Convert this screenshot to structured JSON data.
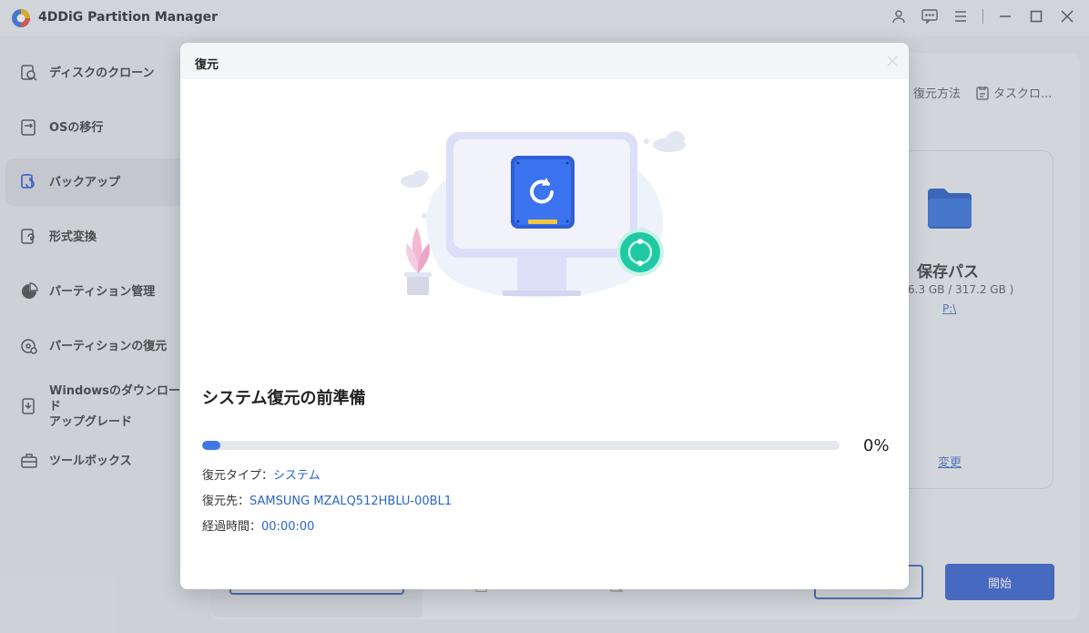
{
  "app": {
    "title": "4DDiG Partition Manager"
  },
  "window_controls": [
    "user-icon",
    "feedback-icon",
    "menu-icon",
    "minimize-icon",
    "maximize-icon",
    "close-icon"
  ],
  "sidebar": {
    "items": [
      {
        "label": "ディスクのクローン",
        "icon": "disk-clone-icon",
        "active": false
      },
      {
        "label": "OSの移行",
        "icon": "os-migrate-icon",
        "active": false
      },
      {
        "label": "バックアップ",
        "icon": "backup-icon",
        "active": true
      },
      {
        "label": "形式変換",
        "icon": "convert-icon",
        "active": false
      },
      {
        "label": "パーティション管理",
        "icon": "partition-icon",
        "active": false
      },
      {
        "label": "パーティションの復元",
        "icon": "partition-recovery-icon",
        "active": false
      },
      {
        "label": "Windowsのダウンロード\nアップグレード",
        "icon": "windows-download-icon",
        "active": false
      },
      {
        "label": "ツールボックス",
        "icon": "toolbox-icon",
        "active": false
      }
    ]
  },
  "background": {
    "toolbar": {
      "restore_method": "復元方法",
      "task_log": "タスクロ..."
    },
    "destination": {
      "title": "保存パス",
      "size": "6.3 GB / 317.2 GB )",
      "path": "P:\\",
      "change": "変更"
    },
    "start_button": "開始"
  },
  "modal": {
    "title": "復元",
    "heading": "システム復元の前準備",
    "progress": {
      "percent": 0,
      "label": "0%"
    },
    "info": [
      {
        "label": "復元タイプ：",
        "value": "システム"
      },
      {
        "label": "復元先：",
        "value": "SAMSUNG MZALQ512HBLU-00BL1"
      },
      {
        "label": "経過時間：",
        "value": "00:00:00"
      }
    ]
  },
  "colors": {
    "accent": "#2e5bd0",
    "progress": "#3f78e6",
    "link": "#2a66c8",
    "teal": "#1fc9a4"
  }
}
